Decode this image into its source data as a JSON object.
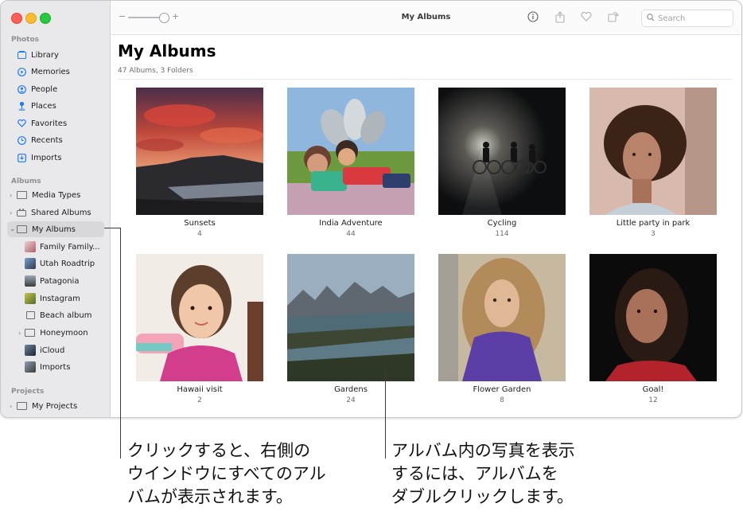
{
  "window": {
    "title": "My Albums",
    "zoom_minus": "−",
    "zoom_plus": "+"
  },
  "toolbar": {
    "search_placeholder": "Search",
    "icons": [
      "info-icon",
      "share-icon",
      "heart-icon",
      "rotate-icon",
      "search-icon"
    ]
  },
  "sidebar": {
    "photos_header": "Photos",
    "photos_items": [
      {
        "label": "Library",
        "icon": "library-icon"
      },
      {
        "label": "Memories",
        "icon": "memories-icon"
      },
      {
        "label": "People",
        "icon": "people-icon"
      },
      {
        "label": "Places",
        "icon": "places-icon"
      },
      {
        "label": "Favorites",
        "icon": "heart-icon"
      },
      {
        "label": "Recents",
        "icon": "clock-icon"
      },
      {
        "label": "Imports",
        "icon": "import-icon"
      }
    ],
    "albums_header": "Albums",
    "album_items": [
      {
        "label": "Media Types"
      },
      {
        "label": "Shared Albums"
      },
      {
        "label": "My Albums"
      }
    ],
    "sub_items": [
      {
        "label": "Family Family..."
      },
      {
        "label": "Utah Roadtrip"
      },
      {
        "label": "Patagonia"
      },
      {
        "label": "Instagram"
      },
      {
        "label": "Beach album"
      },
      {
        "label": "Honeymoon"
      },
      {
        "label": "iCloud"
      },
      {
        "label": "Imports"
      }
    ],
    "projects_header": "Projects",
    "project_items": [
      {
        "label": "My Projects"
      }
    ]
  },
  "main": {
    "title": "My Albums",
    "subtitle": "47 Albums, 3 Folders",
    "albums": [
      {
        "name": "Sunsets",
        "count": "4"
      },
      {
        "name": "India Adventure",
        "count": "44"
      },
      {
        "name": "Cycling",
        "count": "114"
      },
      {
        "name": "Little party in park",
        "count": "3"
      },
      {
        "name": "Hawaii visit",
        "count": "2"
      },
      {
        "name": "Gardens",
        "count": "24"
      },
      {
        "name": "Flower Garden",
        "count": "8"
      },
      {
        "name": "Goal!",
        "count": "12"
      }
    ]
  },
  "callouts": {
    "left": [
      "クリックすると、右側の",
      "ウインドウにすべてのアル",
      "バムが表示されます。"
    ],
    "right": [
      "アルバム内の写真を表示",
      "するには、アルバムを",
      "ダブルクリックします。"
    ]
  }
}
